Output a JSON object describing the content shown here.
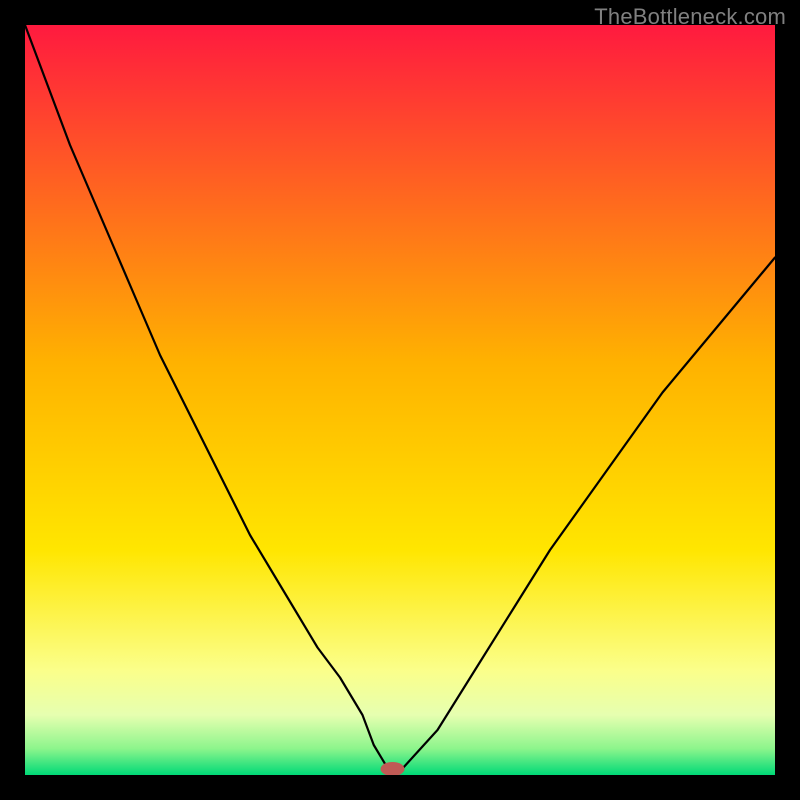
{
  "watermark": "TheBottleneck.com",
  "chart_data": {
    "type": "line",
    "title": "",
    "xlabel": "",
    "ylabel": "",
    "xlim": [
      0,
      100
    ],
    "ylim": [
      0,
      100
    ],
    "x": [
      0,
      3,
      6,
      9,
      12,
      15,
      18,
      21,
      24,
      27,
      30,
      33,
      36,
      39,
      42,
      45,
      46.5,
      48,
      49,
      50,
      55,
      60,
      65,
      70,
      75,
      80,
      85,
      90,
      95,
      100
    ],
    "values": [
      100,
      92,
      84,
      77,
      70,
      63,
      56,
      50,
      44,
      38,
      32,
      27,
      22,
      17,
      13,
      8,
      4,
      1.5,
      0.5,
      0.5,
      6,
      14,
      22,
      30,
      37,
      44,
      51,
      57,
      63,
      69
    ],
    "minimum_x": 49,
    "background_gradient": {
      "stops": [
        {
          "pos": 0.0,
          "color": "#ff1a3f"
        },
        {
          "pos": 0.45,
          "color": "#ffb200"
        },
        {
          "pos": 0.7,
          "color": "#ffe600"
        },
        {
          "pos": 0.86,
          "color": "#fbff8a"
        },
        {
          "pos": 0.92,
          "color": "#e6ffb0"
        },
        {
          "pos": 0.965,
          "color": "#8cf58c"
        },
        {
          "pos": 1.0,
          "color": "#00d977"
        }
      ]
    },
    "marker": {
      "x_frac": 0.49,
      "color": "#c05a55",
      "rx": 12,
      "ry": 7
    }
  }
}
